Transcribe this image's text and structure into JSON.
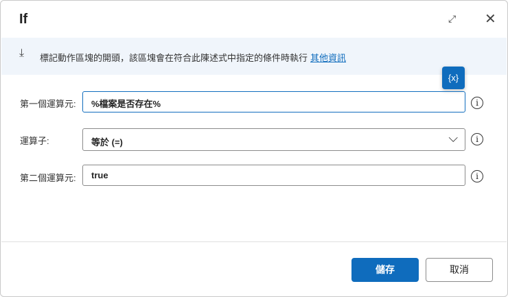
{
  "dialog": {
    "title": "If"
  },
  "banner": {
    "text": "標記動作區塊的開頭，該區塊會在符合此陳述式中指定的條件時執行",
    "link": "其他資訊"
  },
  "variable_button": "{x}",
  "fields": [
    {
      "label": "第一個運算元:",
      "value": "%檔案是否存在%"
    },
    {
      "label": "運算子:",
      "value": "等於 (=)"
    },
    {
      "label": "第二個運算元:",
      "value": "true"
    }
  ],
  "buttons": {
    "save": "儲存",
    "cancel": "取消"
  }
}
